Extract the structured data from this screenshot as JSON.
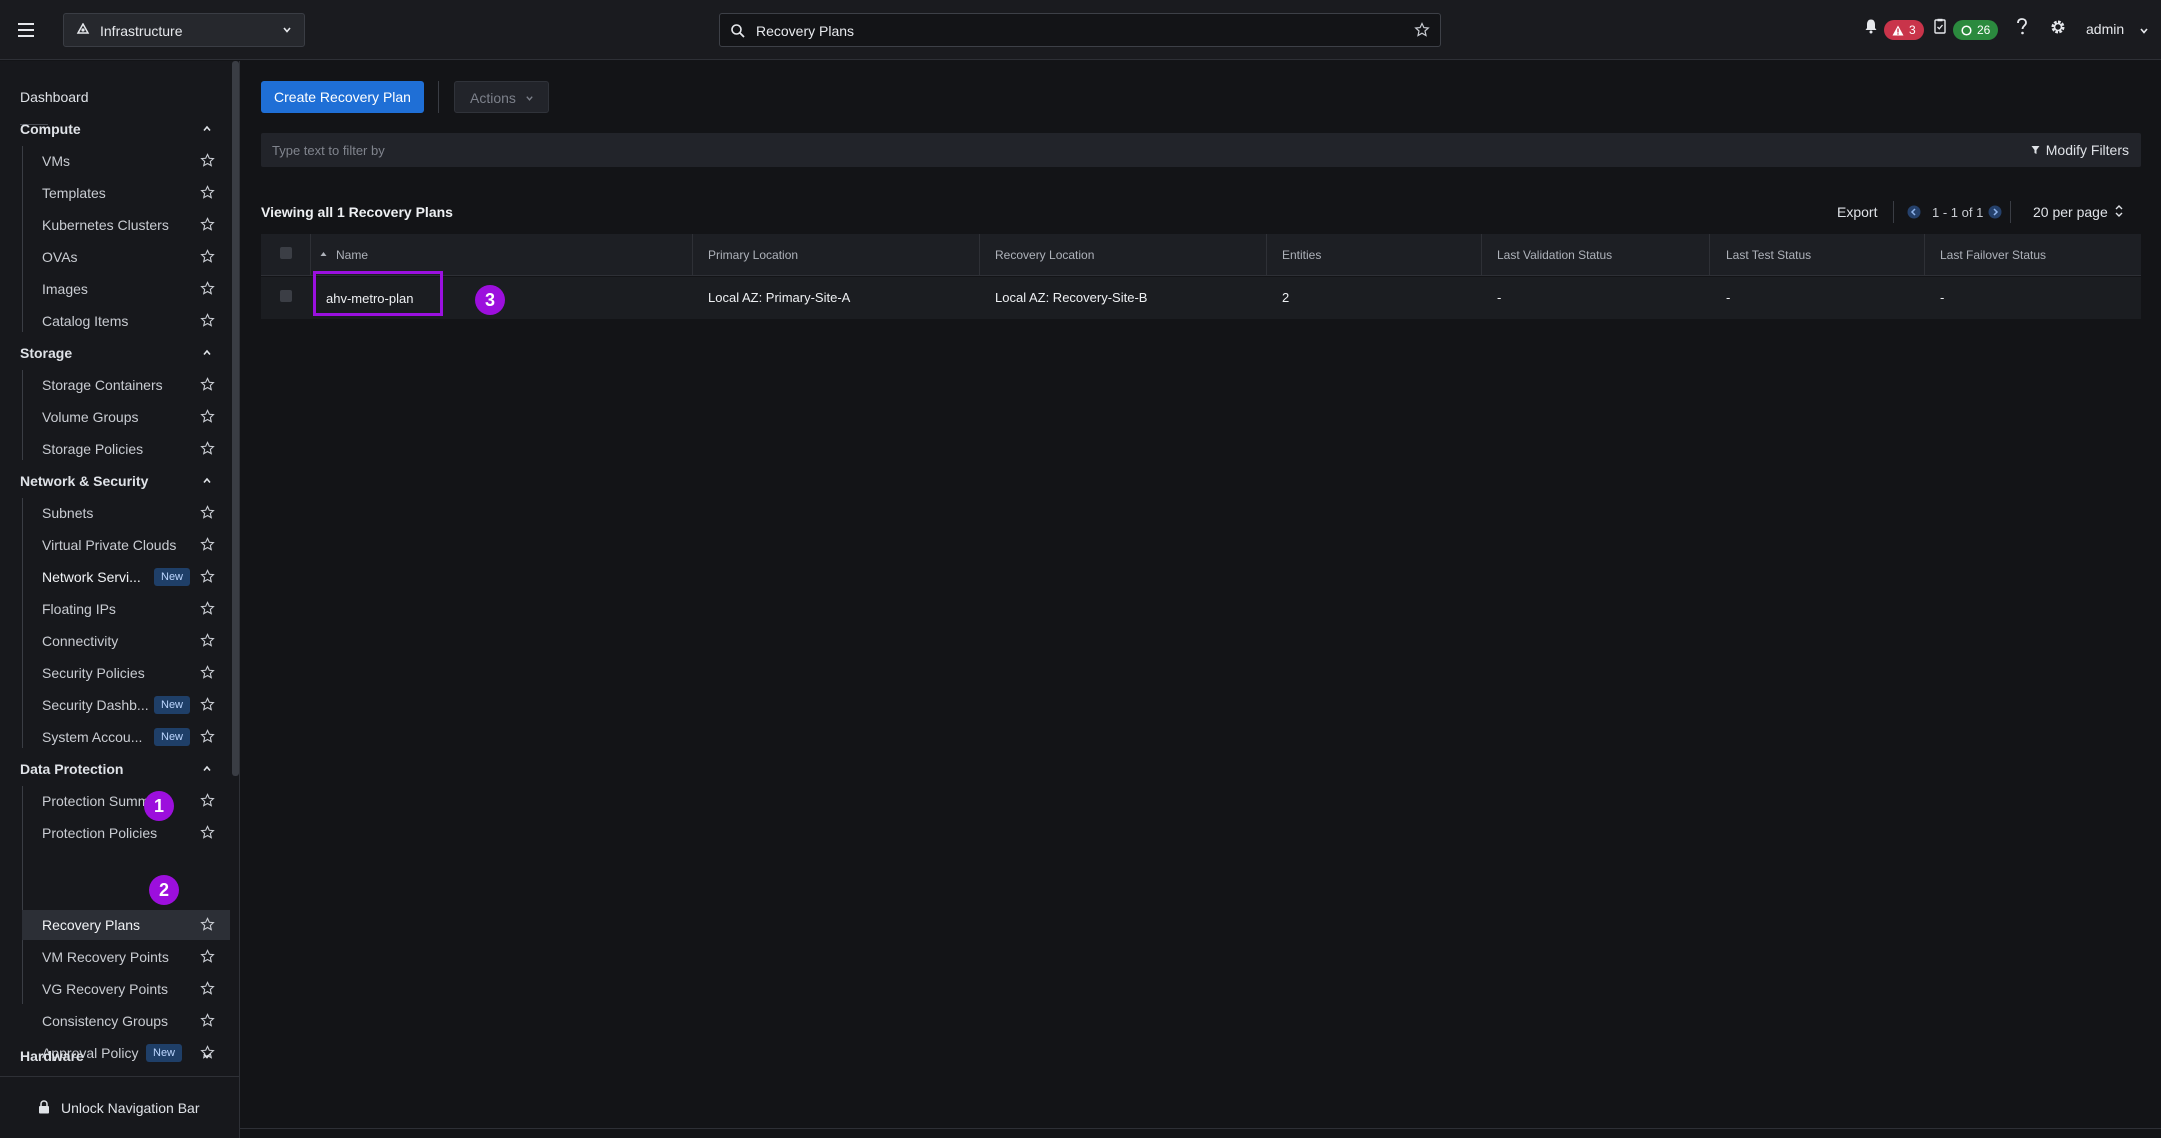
{
  "topbar": {
    "app_switcher_label": "Infrastructure",
    "search_value": "Recovery Plans",
    "alert_count": "3",
    "task_count": "26",
    "user": "admin"
  },
  "sidebar": {
    "dashboard": "Dashboard",
    "groups": {
      "compute": {
        "label": "Compute",
        "items": [
          "VMs",
          "Templates",
          "Kubernetes Clusters",
          "OVAs",
          "Images",
          "Catalog Items"
        ]
      },
      "storage": {
        "label": "Storage",
        "items": [
          "Storage Containers",
          "Volume Groups",
          "Storage Policies"
        ]
      },
      "network": {
        "label": "Network & Security",
        "items": [
          "Subnets",
          "Virtual Private Clouds",
          "Network Servi...",
          "Floating IPs",
          "Connectivity",
          "Security Policies",
          "Security Dashb...",
          "System Accou..."
        ]
      },
      "data_protection": {
        "label": "Data Protection",
        "items": [
          "Protection Summary",
          "Protection Policies",
          "Recovery Plans",
          "VM Recovery Points",
          "VG Recovery Points",
          "Consistency Groups",
          "Approval Policy"
        ]
      },
      "hardware": {
        "label": "Hardware"
      }
    },
    "new_badge": "New",
    "unlock": "Unlock Navigation Bar"
  },
  "main": {
    "create_button": "Create Recovery Plan",
    "actions_button": "Actions",
    "filter_placeholder": "Type text to filter by",
    "modify_filters": "Modify Filters",
    "viewing": "Viewing all 1 Recovery Plans",
    "export": "Export",
    "pagination": "1 - 1 of 1",
    "per_page": "20 per page",
    "table": {
      "columns": [
        "Name",
        "Primary Location",
        "Recovery Location",
        "Entities",
        "Last Validation Status",
        "Last Test Status",
        "Last Failover Status"
      ],
      "rows": [
        [
          "ahv-metro-plan",
          "Local AZ: Primary-Site-A",
          "Local AZ: Recovery-Site-B",
          "2",
          "-",
          "-",
          "-"
        ]
      ]
    }
  },
  "annotations": [
    "1",
    "2",
    "3"
  ],
  "colors": {
    "accent": "#1f6fd6",
    "annotation": "#9c0fdd",
    "alert": "#c9344a",
    "success": "#2b8a3e",
    "new_badge": "#1f3f68"
  }
}
